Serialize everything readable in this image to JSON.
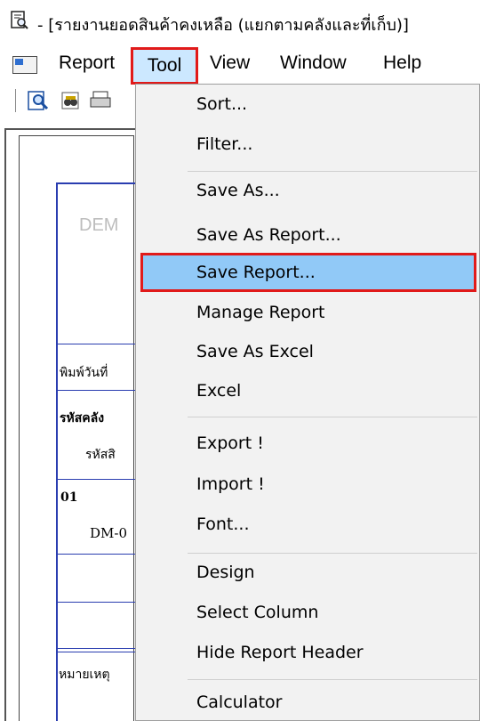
{
  "window": {
    "title": "- [รายงานยอดสินค้าคงเหลือ (แยกตามคลังและที่เก็บ)]"
  },
  "menubar": {
    "items": [
      "Report",
      "Tool",
      "View",
      "Window",
      "Help"
    ],
    "active": "Tool"
  },
  "toolbar": {
    "icons": [
      "preview-icon",
      "binoculars-icon",
      "print-icon"
    ]
  },
  "report_preview": {
    "header_text": "DEM",
    "print_date_label": "พิมพ์วันที่",
    "warehouse_code_label": "รหัสคลัง",
    "product_code_label": "รหัสสิ",
    "row_code": "01",
    "row_item": "DM-0",
    "note_label": "หมายเหตุ"
  },
  "tool_menu": {
    "items": [
      {
        "label": "Sort..."
      },
      {
        "label": "Filter..."
      },
      {
        "label": "Save As..."
      },
      {
        "label": "Save As Report..."
      },
      {
        "label": "Save Report..."
      },
      {
        "label": "Manage Report"
      },
      {
        "label": "Save As Excel"
      },
      {
        "label": "Excel"
      },
      {
        "label": "Export !"
      },
      {
        "label": "Import !"
      },
      {
        "label": "Font..."
      },
      {
        "label": "Design"
      },
      {
        "label": "Select Column"
      },
      {
        "label": "Hide Report Header"
      },
      {
        "label": "Calculator"
      }
    ],
    "highlighted": "Save Report...",
    "highlight_color": "#91c9f7",
    "annotation_color": "#e11a1a"
  }
}
